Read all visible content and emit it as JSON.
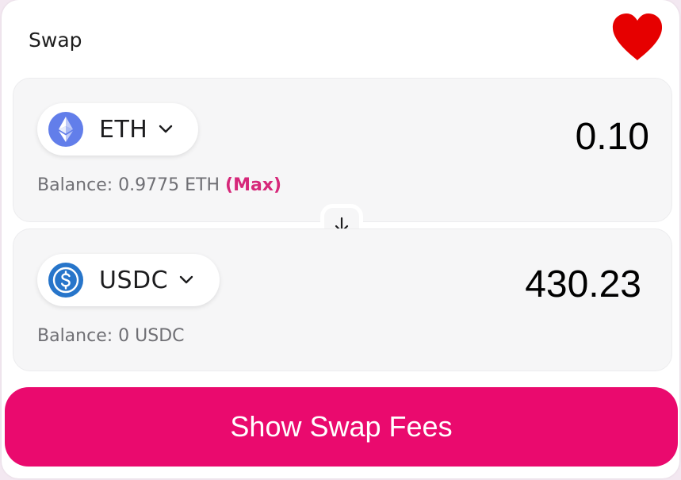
{
  "header": {
    "title": "Swap",
    "favorite_icon": "heart-icon",
    "favorite_color": "#e60000"
  },
  "from": {
    "token_symbol": "ETH",
    "token_icon": "ethereum-icon",
    "amount": "0.10",
    "balance_text": "Balance: 0.9775 ETH",
    "max_label": "(Max)"
  },
  "switch": {
    "icon": "arrow-down-icon"
  },
  "to": {
    "token_symbol": "USDC",
    "token_icon": "usdc-icon",
    "amount": "430.23",
    "balance_text": "Balance: 0 USDC"
  },
  "action": {
    "label": "Show Swap Fees",
    "color": "#ea0a6e"
  },
  "colors": {
    "accent": "#d6287a",
    "eth_icon": "#627eea",
    "usdc_icon": "#2775ca"
  }
}
